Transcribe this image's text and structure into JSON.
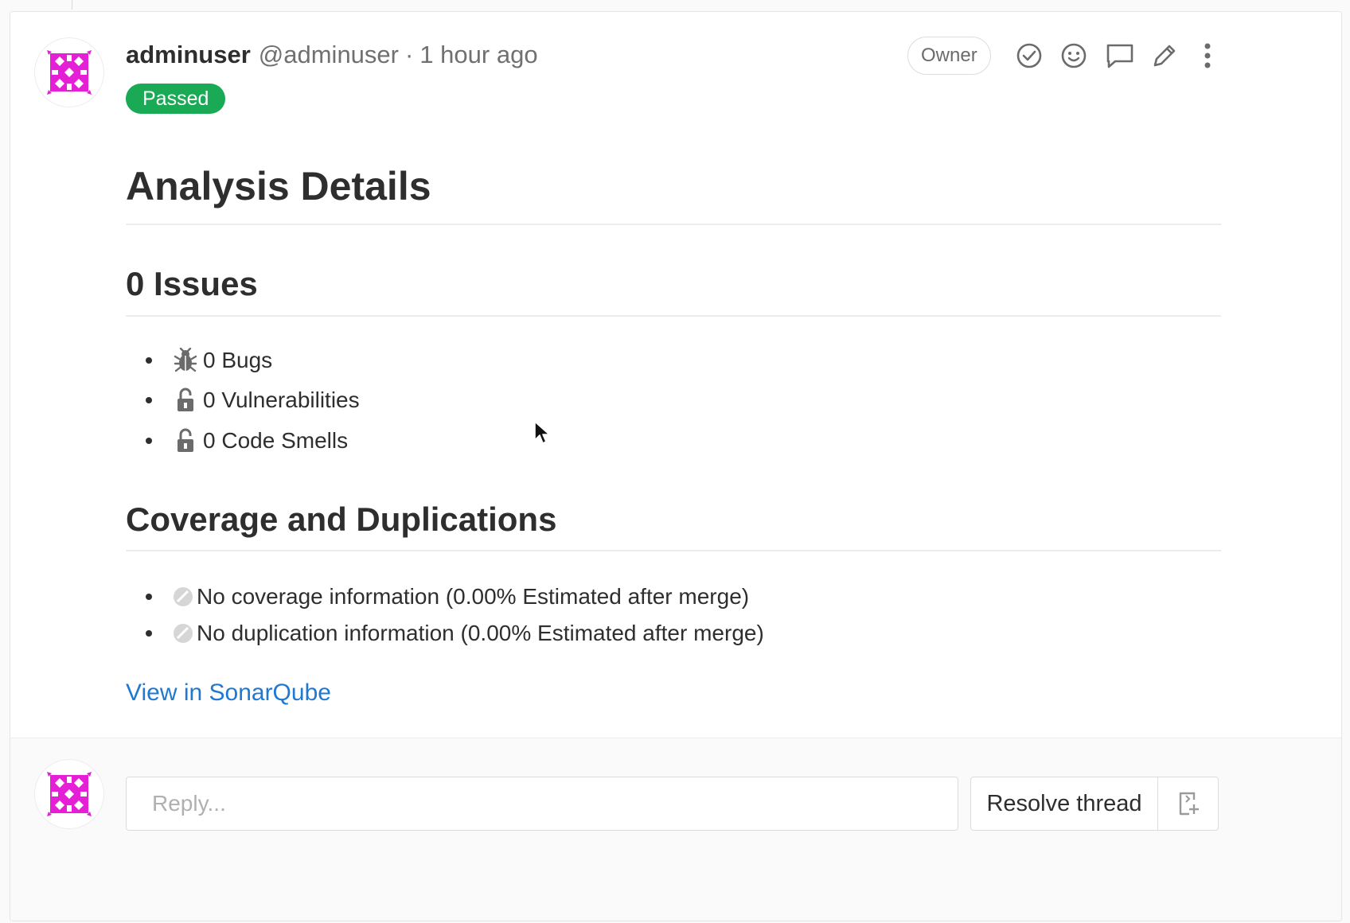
{
  "note": {
    "author_name": "adminuser",
    "author_handle": "@adminuser",
    "separator": "·",
    "time": "1 hour ago",
    "status": "Passed",
    "role_badge": "Owner",
    "actions": [
      "resolve-discussion-icon",
      "emoji-icon",
      "comment-icon",
      "pencil-icon",
      "more-actions-icon"
    ]
  },
  "analysis": {
    "title": "Analysis Details",
    "issues_heading": "0 Issues",
    "issues": [
      {
        "icon": "bug-icon",
        "label": "0 Bugs"
      },
      {
        "icon": "unlock-icon",
        "label": "0 Vulnerabilities"
      },
      {
        "icon": "unlock-icon",
        "label": "0 Code Smells"
      }
    ],
    "coverage_heading": "Coverage and Duplications",
    "coverage": [
      {
        "icon": "no-data-icon",
        "label": "No coverage information (0.00% Estimated after merge)"
      },
      {
        "icon": "no-data-icon",
        "label": "No duplication information (0.00% Estimated after merge)"
      }
    ],
    "link": "View in SonarQube"
  },
  "reply": {
    "placeholder": "Reply...",
    "resolve_label": "Resolve thread",
    "resolve_issue_icon": "create-issue-icon"
  },
  "colors": {
    "status_green": "#1aaa55",
    "link_blue": "#1f78d1",
    "avatar_magenta": "#e41fd6"
  }
}
